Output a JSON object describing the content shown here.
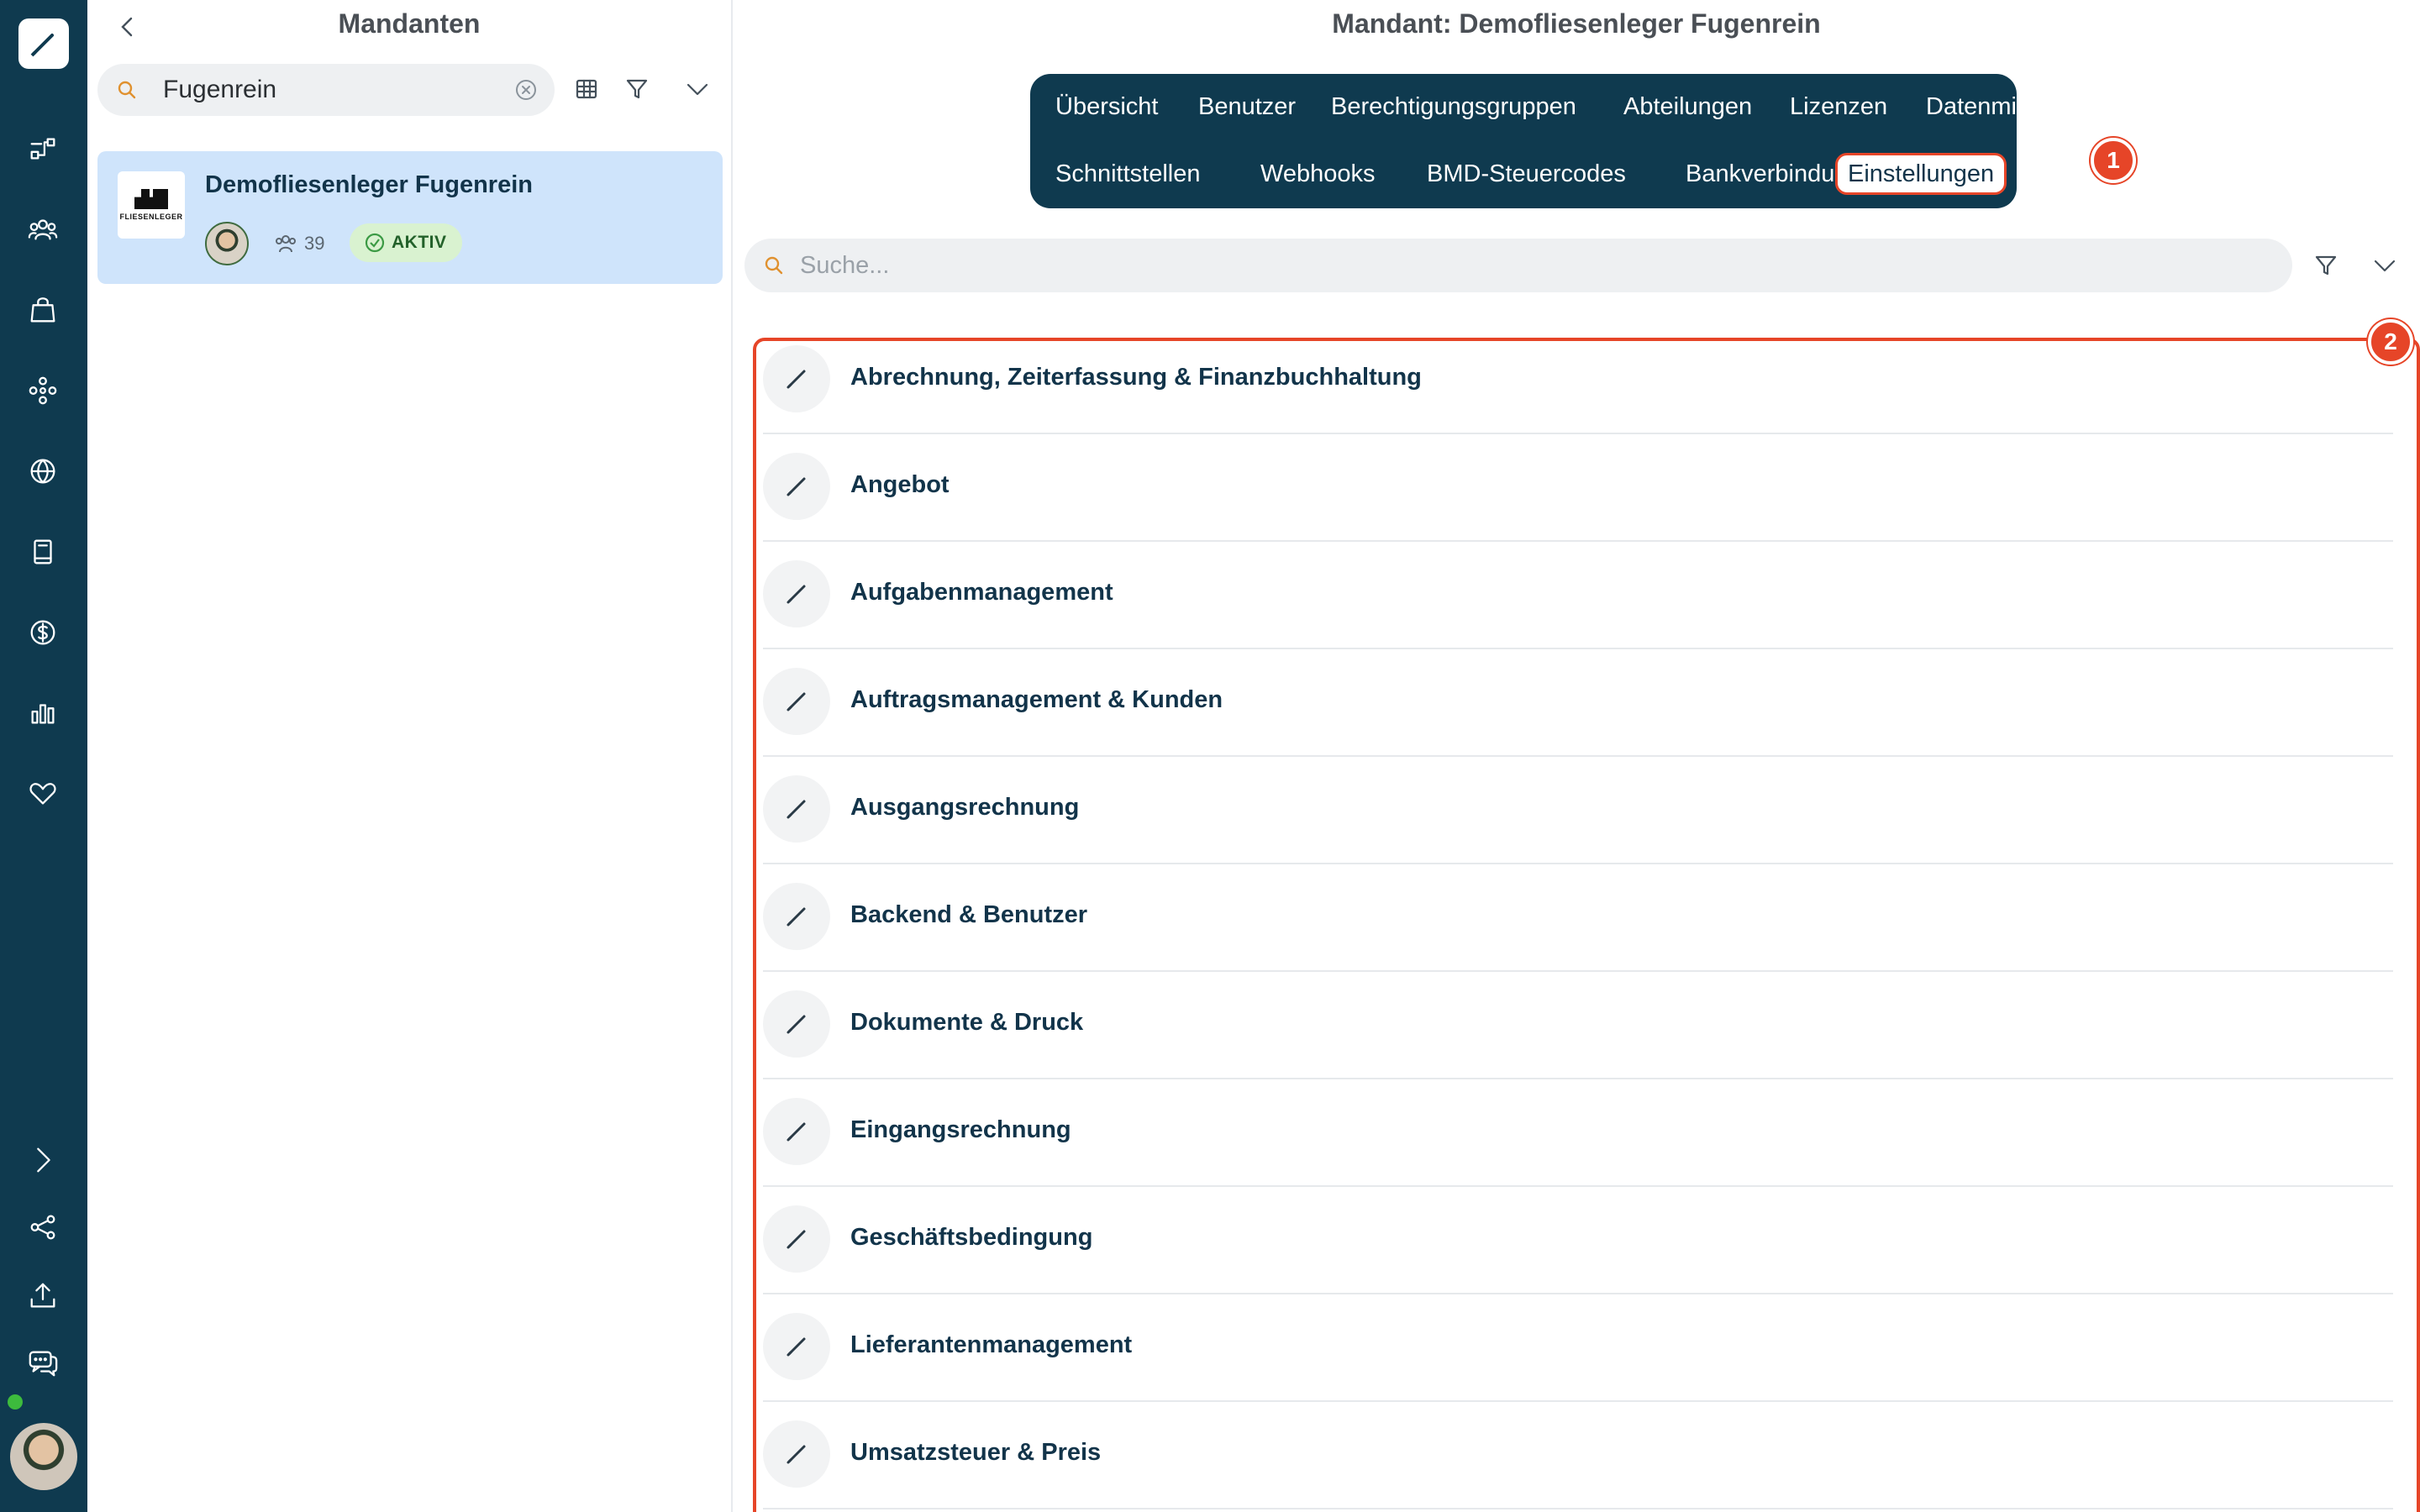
{
  "rail": {
    "icons": [
      "pencil-logo-icon",
      "flow-icon",
      "team-icon",
      "shopping-bag-icon",
      "modules-icon",
      "globe-icon",
      "book-icon",
      "dollar-icon",
      "bar-chart-icon",
      "heart-icon",
      "chevron-right-icon",
      "share-icon",
      "upload-icon",
      "chat-icon"
    ]
  },
  "list_panel": {
    "title": "Mandanten",
    "search": {
      "value": "Fugenrein"
    },
    "client": {
      "name": "Demofliesenleger Fugenrein",
      "logo_text": "FLIESENLEGER",
      "user_count": "39",
      "status": "AKTIV"
    }
  },
  "detail": {
    "title": "Mandant: Demofliesenleger Fugenrein",
    "tabs_row1": [
      "Übersicht",
      "Benutzer",
      "Berechtigungsgruppen",
      "Abteilungen",
      "Lizenzen",
      "Datenmigration"
    ],
    "tabs_row2": [
      "Schnittstellen",
      "Webhooks",
      "BMD-Steuercodes",
      "Bankverbindungen",
      "Einstellungen"
    ],
    "active_tab": "Einstellungen",
    "markers": [
      "1",
      "2"
    ],
    "search": {
      "placeholder": "Suche..."
    },
    "settings": [
      "Abrechnung, Zeiterfassung & Finanzbuchhaltung",
      "Angebot",
      "Aufgabenmanagement",
      "Auftragsmanagement & Kunden",
      "Ausgangsrechnung",
      "Backend & Benutzer",
      "Dokumente & Druck",
      "Eingangsrechnung",
      "Geschäftsbedingung",
      "Lieferantenmanagement",
      "Umsatzsteuer & Preis"
    ]
  },
  "colors": {
    "rail": "#0f3a4f",
    "highlight": "#e64528",
    "selected_card": "#cfe4fb",
    "status_green": "#d9f2d0"
  }
}
